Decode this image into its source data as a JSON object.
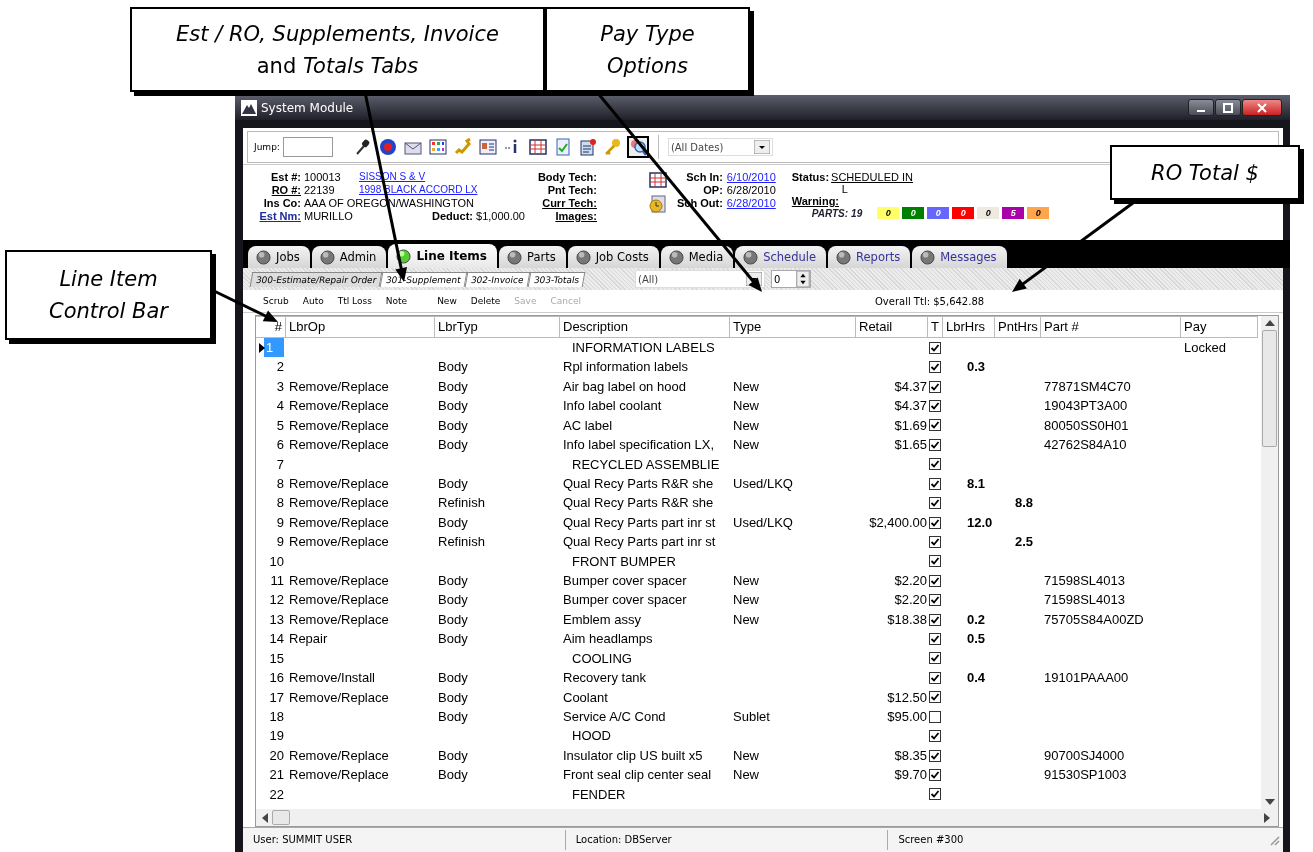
{
  "callouts": [
    {
      "lines": [
        "*Est / RO, Supplements, Invoice*",
        "and *Totals Tabs*"
      ],
      "italic": false
    },
    {
      "lines": [
        "Pay Type",
        "Options"
      ],
      "italic": true
    },
    {
      "lines": [
        "RO Total $"
      ],
      "italic": true
    },
    {
      "lines": [
        "Line Item",
        "Control Bar"
      ],
      "italic": true
    }
  ],
  "window": {
    "title": "System Module"
  },
  "toolbar": {
    "jump_label": "Jump:",
    "buttons": [
      {
        "pressed": false
      },
      {
        "pressed": false
      },
      {
        "pressed": false
      },
      {
        "pressed": false
      },
      {
        "pressed": false
      },
      {
        "pressed": false
      },
      {
        "pressed": false
      },
      {
        "pressed": false
      },
      {
        "pressed": false
      },
      {
        "pressed": false
      },
      {
        "pressed": false
      },
      {
        "pressed": true
      }
    ],
    "date_filter": "(All Dates)"
  },
  "record": {
    "fields": [
      {
        "label": "Est #:",
        "underlined": false,
        "is_link": false,
        "value": "100013",
        "link": "SISSON S & V"
      },
      {
        "label": "RO #:",
        "underlined": true,
        "is_link": false,
        "value": "22139",
        "link": "1998 BLACK ACCORD LX"
      },
      {
        "label": "Ins Co:",
        "underlined": false,
        "is_link": false,
        "value": "AAA OF OREGON/WASHINGTON"
      },
      {
        "label": "Est Nm:",
        "underlined": true,
        "is_link": true,
        "value": "MURILLO"
      }
    ],
    "deduct": {
      "label": "Deduct:",
      "value": "$1,000.00"
    },
    "techs": [
      {
        "label": "Body Tech:",
        "underlined": false
      },
      {
        "label": "Pnt Tech:",
        "underlined": false
      },
      {
        "label": "Curr Tech:",
        "underlined": true
      },
      {
        "label": "Images:",
        "underlined": true
      }
    ],
    "schedule": [
      {
        "label": "Sch In:",
        "value": "6/10/2010",
        "is_link": true
      },
      {
        "label": "OP:",
        "value": "6/28/2010",
        "is_link": false
      },
      {
        "label": "Sch Out:",
        "value": "6/28/2010",
        "is_link": true
      }
    ],
    "status": {
      "label": "Status:",
      "value": "SCHEDULED IN",
      "marker": "L"
    },
    "warning": {
      "label": "Warning:"
    },
    "parts": {
      "label": "PARTS:",
      "count": "19",
      "badges": [
        {
          "text": "0",
          "color": "#ffff66"
        },
        {
          "text": "0",
          "color": "#008000"
        },
        {
          "text": "0",
          "color": "#6666ff"
        },
        {
          "text": "0",
          "color": "#ff0000"
        },
        {
          "text": "0",
          "color": "#eeeae0"
        },
        {
          "text": "5",
          "color": "#aa00aa"
        },
        {
          "text": "0",
          "color": "#ffa64d"
        }
      ]
    }
  },
  "tabs": [
    {
      "label": "Jobs",
      "selected": false,
      "color": "#000000"
    },
    {
      "label": "Admin",
      "selected": false,
      "color": "#000000"
    },
    {
      "label": "Line Items",
      "selected": true,
      "color": "#000000"
    },
    {
      "label": "Parts",
      "selected": false,
      "color": "#000000"
    },
    {
      "label": "Job Costs",
      "selected": false,
      "color": "#000000"
    },
    {
      "label": "Media",
      "selected": false,
      "color": "#000000"
    },
    {
      "label": "Schedule",
      "selected": false,
      "color": "#333399"
    },
    {
      "label": "Reports",
      "selected": false,
      "color": "#333399"
    },
    {
      "label": "Messages",
      "selected": false,
      "color": "#333399"
    }
  ],
  "subtabs": [
    {
      "label": "300-Estimate/Repair Order",
      "selected": true
    },
    {
      "label": "301-Supplement",
      "selected": false
    },
    {
      "label": "302-Invoice",
      "selected": false
    },
    {
      "label": "303-Totals",
      "selected": false
    }
  ],
  "filter": {
    "value": "(All)",
    "spin_value": "0"
  },
  "control_bar": {
    "buttons": [
      {
        "label": "Scrub",
        "disabled": false
      },
      {
        "label": "Auto",
        "disabled": false
      },
      {
        "label": "Ttl Loss",
        "disabled": false
      },
      {
        "label": "Note",
        "disabled": false
      },
      {
        "label": "New",
        "disabled": false
      },
      {
        "label": "Delete",
        "disabled": false
      },
      {
        "label": "Save",
        "disabled": true
      },
      {
        "label": "Cancel",
        "disabled": true
      }
    ],
    "overall_total": "Overall Ttl:  $5,642.88"
  },
  "table": {
    "columns": [
      "#",
      "LbrOp",
      "LbrTyp",
      "Description",
      "Type",
      "Retail",
      "T",
      "LbrHrs",
      "PntHrs",
      "Part #",
      "Pay"
    ],
    "rows": [
      {
        "kind": "section",
        "num": "1",
        "description": "INFORMATION LABELS",
        "taxed": true,
        "pay": "Locked",
        "selected": true
      },
      {
        "kind": "line",
        "num": "2",
        "lbr_typ": "Body",
        "description": "Rpl information labels",
        "taxed": true,
        "lbr_hrs": "0.3",
        "selected": false
      },
      {
        "kind": "line",
        "num": "3",
        "lbr_op": "Remove/Replace",
        "lbr_typ": "Body",
        "description": "Air bag label on hood",
        "type": "New",
        "retail": "$4.37",
        "taxed": true,
        "part": "77871SM4C70",
        "selected": false
      },
      {
        "kind": "line",
        "num": "4",
        "lbr_op": "Remove/Replace",
        "lbr_typ": "Body",
        "description": "Info label coolant",
        "type": "New",
        "retail": "$4.37",
        "taxed": true,
        "part": "19043PT3A00",
        "selected": false
      },
      {
        "kind": "line",
        "num": "5",
        "lbr_op": "Remove/Replace",
        "lbr_typ": "Body",
        "description": "AC label",
        "type": "New",
        "retail": "$1.69",
        "taxed": true,
        "part": "80050SS0H01",
        "selected": false
      },
      {
        "kind": "line",
        "num": "6",
        "lbr_op": "Remove/Replace",
        "lbr_typ": "Body",
        "description": "Info label specification LX,",
        "type": "New",
        "retail": "$1.65",
        "taxed": true,
        "part": "42762S84A10",
        "selected": false
      },
      {
        "kind": "section",
        "num": "7",
        "description": "RECYCLED ASSEMBLIE",
        "taxed": true,
        "selected": false
      },
      {
        "kind": "line",
        "num": "8",
        "lbr_op": "Remove/Replace",
        "lbr_typ": "Body",
        "description": "Qual Recy Parts  R&R she",
        "type": "Used/LKQ",
        "taxed": true,
        "lbr_hrs": "8.1",
        "selected": false
      },
      {
        "kind": "line",
        "num": "8",
        "lbr_op": "Remove/Replace",
        "lbr_typ": "Refinish",
        "description": "Qual Recy Parts  R&R she",
        "taxed": true,
        "pnt_hrs": "8.8",
        "selected": false
      },
      {
        "kind": "line",
        "num": "9",
        "lbr_op": "Remove/Replace",
        "lbr_typ": "Body",
        "description": "Qual Recy Parts part inr st",
        "type": "Used/LKQ",
        "retail": "$2,400.00",
        "taxed": true,
        "lbr_hrs": "12.0",
        "selected": false
      },
      {
        "kind": "line",
        "num": "9",
        "lbr_op": "Remove/Replace",
        "lbr_typ": "Refinish",
        "description": "Qual Recy Parts part inr st",
        "taxed": true,
        "pnt_hrs": "2.5",
        "selected": false
      },
      {
        "kind": "section",
        "num": "10",
        "description": "FRONT BUMPER",
        "taxed": true,
        "selected": false
      },
      {
        "kind": "line",
        "num": "11",
        "lbr_op": "Remove/Replace",
        "lbr_typ": "Body",
        "description": "Bumper cover spacer",
        "type": "New",
        "retail": "$2.20",
        "taxed": true,
        "part": "71598SL4013",
        "selected": false
      },
      {
        "kind": "line",
        "num": "12",
        "lbr_op": "Remove/Replace",
        "lbr_typ": "Body",
        "description": "Bumper cover spacer",
        "type": "New",
        "retail": "$2.20",
        "taxed": true,
        "part": "71598SL4013",
        "selected": false
      },
      {
        "kind": "line",
        "num": "13",
        "lbr_op": "Remove/Replace",
        "lbr_typ": "Body",
        "description": "Emblem assy",
        "type": "New",
        "retail": "$18.38",
        "taxed": true,
        "lbr_hrs": "0.2",
        "part": "75705S84A00ZD",
        "selected": false
      },
      {
        "kind": "line",
        "num": "14",
        "lbr_op": "Repair",
        "lbr_typ": "Body",
        "description": "Aim headlamps",
        "taxed": true,
        "lbr_hrs": "0.5",
        "selected": false
      },
      {
        "kind": "section",
        "num": "15",
        "description": "COOLING",
        "taxed": true,
        "selected": false
      },
      {
        "kind": "line",
        "num": "16",
        "lbr_op": "Remove/Install",
        "lbr_typ": "Body",
        "description": "Recovery tank",
        "taxed": true,
        "lbr_hrs": "0.4",
        "part": "19101PAAA00",
        "selected": false
      },
      {
        "kind": "line",
        "num": "17",
        "lbr_op": "Remove/Replace",
        "lbr_typ": "Body",
        "description": "Coolant",
        "retail": "$12.50",
        "taxed": true,
        "selected": false
      },
      {
        "kind": "line",
        "num": "18",
        "lbr_typ": "Body",
        "description": "Service A/C Cond",
        "type": "Sublet",
        "retail": "$95.00",
        "taxed": false,
        "selected": false
      },
      {
        "kind": "section",
        "num": "19",
        "description": "HOOD",
        "taxed": true,
        "selected": false
      },
      {
        "kind": "line",
        "num": "20",
        "lbr_op": "Remove/Replace",
        "lbr_typ": "Body",
        "description": "Insulator clip US built x5",
        "type": "New",
        "retail": "$8.35",
        "taxed": true,
        "part": "90700SJ4000",
        "selected": false
      },
      {
        "kind": "line",
        "num": "21",
        "lbr_op": "Remove/Replace",
        "lbr_typ": "Body",
        "description": "Front seal clip center seal",
        "type": "New",
        "retail": "$9.70",
        "taxed": true,
        "part": "91530SP1003",
        "selected": false
      },
      {
        "kind": "section",
        "num": "22",
        "description": "FENDER",
        "taxed": true,
        "selected": false
      }
    ]
  },
  "status_bar": [
    "User: SUMMIT USER",
    "Location: DBServer",
    "Screen #300"
  ]
}
